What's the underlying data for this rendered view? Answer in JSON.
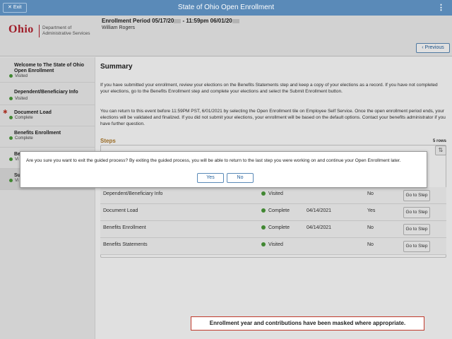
{
  "topbar": {
    "exit_label": "Exit",
    "title": "State of Ohio Open Enrollment"
  },
  "header": {
    "logo_text": "Ohio",
    "dept_line1": "Department of",
    "dept_line2": "Administrative Services",
    "period_prefix": "Enrollment Period 05/17/20",
    "period_middle": " - 11:59pm 06/01/20",
    "person": "William Rogers",
    "previous_label": "Previous"
  },
  "sidebar": {
    "items": [
      {
        "label": "Welcome to The State of Ohio Open Enrollment",
        "status": "Visited"
      },
      {
        "label": "Dependent/Beneficiary Info",
        "status": "Visited"
      },
      {
        "label": "Document Load",
        "status": "Complete"
      },
      {
        "label": "Benefits Enrollment",
        "status": "Complete"
      },
      {
        "label": "Be",
        "status": "Vi"
      },
      {
        "label": "Su",
        "status": "Vi"
      }
    ]
  },
  "main": {
    "title": "Summary",
    "para1": "If you have submitted your enrollment, review your elections on the Benefits Statements step and keep a copy of your elections as a record. If you have not completed your elections, go to the Benefits Enrollment step and complete your elections and select the Submit Enrollment button.",
    "para2": "You can return to this event before 11:59PM PST, 6/01/2021 by selecting the Open Enrollment tile on Employee Self Service. Once the open enrollment period ends, your elections will be validated and finalized. If you did not submit your elections, your enrollment will be based on the default options. Contact your benefits administrator if you have further question.",
    "steps_title": "Steps",
    "rows_count": "5 rows",
    "rows": [
      {
        "step": "Dependent/Beneficiary Info",
        "status": "Visited",
        "date": "",
        "required": "No",
        "button": "Go to Step"
      },
      {
        "step": "Document Load",
        "status": "Complete",
        "date": "04/14/2021",
        "required": "Yes",
        "button": "Go to Step"
      },
      {
        "step": "Benefits Enrollment",
        "status": "Complete",
        "date": "04/14/2021",
        "required": "No",
        "button": "Go to Step"
      },
      {
        "step": "Benefits Statements",
        "status": "Visited",
        "date": "",
        "required": "No",
        "button": "Go to Step"
      }
    ]
  },
  "dialog": {
    "message": "Are you sure you want to exit the guided process? By exiting the guided process, you will be able to return to the last step you were working on and continue your Open Enrollment later.",
    "yes_label": "Yes",
    "no_label": "No"
  },
  "notice": "Enrollment year and contributions have been masked where appropriate.",
  "colors": {
    "topbar": "#5a8ab8",
    "accent_link": "#1f5c99",
    "logo_red": "#b5202e",
    "steps_title": "#b07a2a",
    "status_green": "#4a9a3a"
  }
}
